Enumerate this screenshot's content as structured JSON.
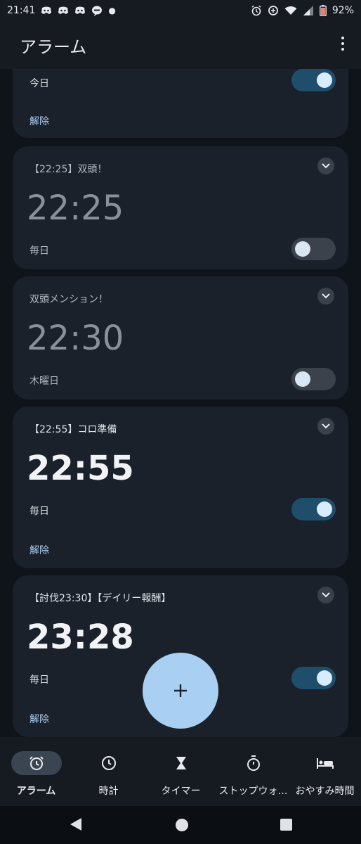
{
  "status_bar": {
    "time": "21:41",
    "battery": "92%",
    "notification_icons": [
      "discord-icon",
      "discord-icon",
      "discord-icon",
      "line-icon",
      "dot-icon"
    ],
    "system_icons": [
      "alarm-icon",
      "data-saver-icon",
      "wifi-icon",
      "signal-icon",
      "battery-icon"
    ]
  },
  "app_bar": {
    "title": "アラーム"
  },
  "alarms": [
    {
      "label": "",
      "time": "",
      "days": "今日",
      "enabled": true,
      "dismiss": "解除"
    },
    {
      "label": "【22:25】双頭！",
      "time": "22:25",
      "days": "毎日",
      "enabled": false,
      "dismiss": ""
    },
    {
      "label": "双頭メンション！",
      "time": "22:30",
      "days": "木曜日",
      "enabled": false,
      "dismiss": ""
    },
    {
      "label": "【22:55】コロ準備",
      "time": "22:55",
      "days": "毎日",
      "enabled": true,
      "dismiss": "解除"
    },
    {
      "label": "【討伐23:30】【デイリー報酬】",
      "time": "23:28",
      "days": "毎日",
      "enabled": true,
      "dismiss": "解除"
    }
  ],
  "fab": {
    "symbol": "+"
  },
  "bottom_nav": [
    {
      "label": "アラーム",
      "icon": "alarm-icon",
      "active": true
    },
    {
      "label": "時計",
      "icon": "clock-icon",
      "active": false
    },
    {
      "label": "タイマー",
      "icon": "hourglass-icon",
      "active": false
    },
    {
      "label": "ストップウォ…",
      "icon": "stopwatch-icon",
      "active": false
    },
    {
      "label": "おやすみ時間",
      "icon": "bed-icon",
      "active": false
    }
  ],
  "colors": {
    "background": "#0f131a",
    "card": "#1b212a",
    "accent": "#a9cdf1",
    "toggle_on": "#1f4d6c",
    "fab": "#a9d0f2"
  }
}
